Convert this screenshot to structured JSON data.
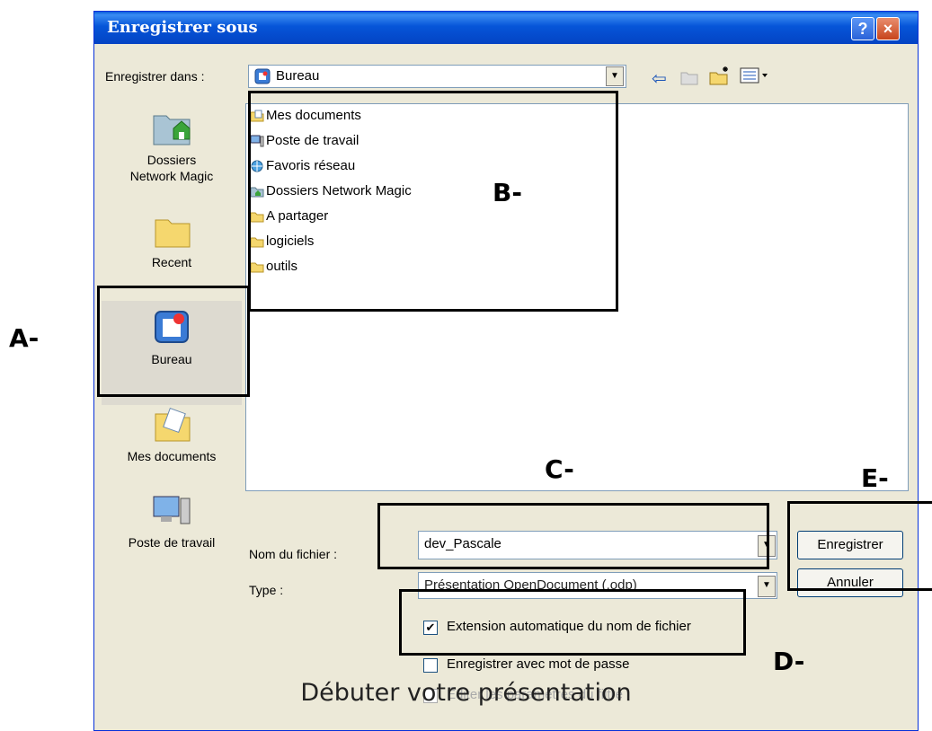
{
  "dialog": {
    "title": "Enregistrer sous",
    "help_label": "?",
    "close_label": "×"
  },
  "save_in": {
    "label": "Enregistrer dans :",
    "value": "Bureau"
  },
  "places": [
    {
      "label": "Dossiers\nNetwork Magic",
      "icon": "network-magic-folder-icon"
    },
    {
      "label": "Recent",
      "icon": "folder-icon"
    },
    {
      "label": "Bureau",
      "icon": "desktop-icon"
    },
    {
      "label": "Mes documents",
      "icon": "my-documents-icon"
    },
    {
      "label": "Poste de travail",
      "icon": "computer-icon"
    }
  ],
  "files": [
    {
      "name": "Mes documents",
      "icon": "my-documents-icon"
    },
    {
      "name": "Poste de travail",
      "icon": "computer-icon"
    },
    {
      "name": "Favoris réseau",
      "icon": "network-icon"
    },
    {
      "name": "Dossiers Network Magic",
      "icon": "network-magic-folder-icon"
    },
    {
      "name": "A partager",
      "icon": "folder-icon"
    },
    {
      "name": "logiciels",
      "icon": "folder-icon"
    },
    {
      "name": "outils",
      "icon": "folder-icon"
    }
  ],
  "filename": {
    "label": "Nom du fichier :",
    "value": "dev_Pascale"
  },
  "filetype": {
    "label": "Type :",
    "value": "Présentation OpenDocument (.odp)"
  },
  "options": {
    "auto_extension_label": "Extension automatique du nom de fichier",
    "auto_extension_checked": true,
    "password_label": "Enregistrer avec mot de passe",
    "password_checked": false,
    "filter_label": "Éditer les paramètres du filtre"
  },
  "buttons": {
    "save": "Enregistrer",
    "cancel": "Annuler"
  },
  "annotations": {
    "a": "A-",
    "b": "B-",
    "c": "C-",
    "d": "D-",
    "e": "E-"
  },
  "caption": "Débuter votre présentation",
  "colors": {
    "titlebar": "#0655d8",
    "dialog_bg": "#ece9d8",
    "field_border": "#7f9db9",
    "folder": "#f5d76e"
  }
}
